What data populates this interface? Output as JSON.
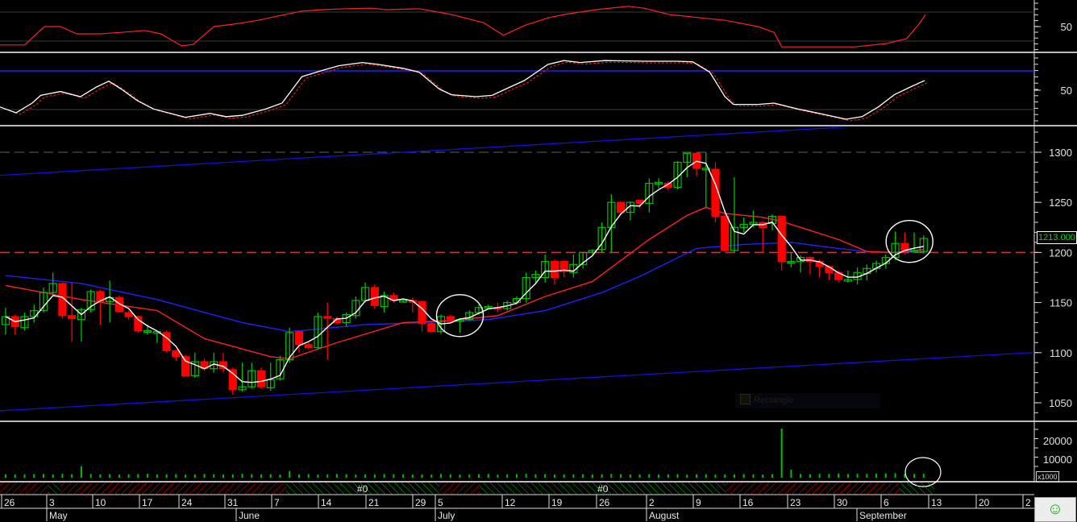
{
  "colors": {
    "bull": "#00c000",
    "bear": "#ff0000",
    "fast_ma": "#ffffff",
    "mid_ma": "#ff2020",
    "slow_ma": "#2020ff",
    "channel": "#1010e0",
    "bg": "#000000",
    "grid": "#3a3a3a"
  },
  "price_tag": "1213.000",
  "volume_unit": "x1000",
  "smiley_icon": "☺",
  "rectangle_label": "Rectangle",
  "chart_data": {
    "type": "candlestick",
    "ylim": [
      1035,
      1325
    ],
    "yticks": [
      "1050",
      "1100",
      "1150",
      "1200",
      "1250",
      "1300"
    ],
    "horizontal_lines": [
      {
        "price": 1300,
        "style": "dashed",
        "color": "#606060"
      },
      {
        "price": 1200,
        "style": "dashed",
        "color": "#ff2020"
      }
    ],
    "trendlines": [
      {
        "from": [
          -0.6,
          1277
        ],
        "to": [
          88.4,
          1325
        ]
      },
      {
        "from": [
          -0.6,
          1042
        ],
        "to": [
          108.4,
          1100
        ]
      }
    ],
    "circles": [
      {
        "slot": 48,
        "price": 1137
      },
      {
        "slot": 95.5,
        "price": 1211
      }
    ],
    "candles": [
      [
        1128,
        1145,
        1118,
        1136
      ],
      [
        1136,
        1138,
        1118,
        1126
      ],
      [
        1125,
        1140,
        1122,
        1136
      ],
      [
        1136,
        1148,
        1130,
        1142
      ],
      [
        1142,
        1165,
        1140,
        1160
      ],
      [
        1160,
        1180,
        1158,
        1169
      ],
      [
        1169,
        1170,
        1134,
        1137
      ],
      [
        1137,
        1170,
        1111,
        1134
      ],
      [
        1133,
        1145,
        1111,
        1143
      ],
      [
        1143,
        1163,
        1140,
        1161
      ],
      [
        1161,
        1163,
        1128,
        1151
      ],
      [
        1151,
        1172,
        1130,
        1155
      ],
      [
        1155,
        1157,
        1140,
        1141
      ],
      [
        1140,
        1142,
        1133,
        1136
      ],
      [
        1136,
        1137,
        1120,
        1122
      ],
      [
        1122,
        1128,
        1118,
        1122
      ],
      [
        1121,
        1122,
        1110,
        1121
      ],
      [
        1120,
        1122,
        1100,
        1102
      ],
      [
        1102,
        1103,
        1092,
        1096
      ],
      [
        1096,
        1098,
        1076,
        1077
      ],
      [
        1077,
        1100,
        1075,
        1091
      ],
      [
        1091,
        1094,
        1082,
        1084
      ],
      [
        1084,
        1100,
        1080,
        1091
      ],
      [
        1091,
        1100,
        1080,
        1084
      ],
      [
        1083,
        1085,
        1058,
        1063
      ],
      [
        1063,
        1090,
        1061,
        1066
      ],
      [
        1066,
        1090,
        1064,
        1082
      ],
      [
        1082,
        1085,
        1064,
        1066
      ],
      [
        1065,
        1090,
        1062,
        1073
      ],
      [
        1074,
        1097,
        1072,
        1093
      ],
      [
        1093,
        1125,
        1090,
        1120
      ],
      [
        1121,
        1122,
        1100,
        1108
      ],
      [
        1108,
        1110,
        1104,
        1105
      ],
      [
        1105,
        1140,
        1103,
        1136
      ],
      [
        1136,
        1150,
        1093,
        1135
      ],
      [
        1134,
        1136,
        1128,
        1130
      ],
      [
        1130,
        1140,
        1126,
        1138
      ],
      [
        1137,
        1156,
        1134,
        1152
      ],
      [
        1152,
        1170,
        1150,
        1165
      ],
      [
        1165,
        1168,
        1144,
        1147
      ],
      [
        1146,
        1161,
        1140,
        1157
      ],
      [
        1157,
        1160,
        1150,
        1152
      ],
      [
        1152,
        1153,
        1150,
        1152
      ],
      [
        1152,
        1155,
        1140,
        1151
      ],
      [
        1151,
        1152,
        1121,
        1129
      ],
      [
        1129,
        1130,
        1120,
        1121
      ],
      [
        1121,
        1138,
        1119,
        1136
      ],
      [
        1136,
        1138,
        1130,
        1132
      ],
      [
        1133,
        1134,
        1120,
        1133
      ],
      [
        1133,
        1142,
        1132,
        1140
      ],
      [
        1140,
        1148,
        1138,
        1145
      ],
      [
        1146,
        1148,
        1143,
        1146
      ],
      [
        1145,
        1150,
        1140,
        1144
      ],
      [
        1144,
        1152,
        1142,
        1150
      ],
      [
        1150,
        1156,
        1148,
        1154
      ],
      [
        1154,
        1180,
        1150,
        1175
      ],
      [
        1175,
        1182,
        1168,
        1178
      ],
      [
        1175,
        1198,
        1170,
        1191
      ],
      [
        1191,
        1193,
        1168,
        1175
      ],
      [
        1191,
        1192,
        1175,
        1181
      ],
      [
        1180,
        1198,
        1175,
        1188
      ],
      [
        1188,
        1200,
        1184,
        1200
      ],
      [
        1200,
        1203,
        1196,
        1202
      ],
      [
        1203,
        1230,
        1200,
        1225
      ],
      [
        1225,
        1258,
        1200,
        1250
      ],
      [
        1250,
        1251,
        1238,
        1240
      ],
      [
        1240,
        1251,
        1232,
        1250
      ],
      [
        1252,
        1253,
        1244,
        1249
      ],
      [
        1249,
        1274,
        1240,
        1269
      ],
      [
        1270,
        1274,
        1264,
        1270
      ],
      [
        1269,
        1271,
        1262,
        1265
      ],
      [
        1265,
        1291,
        1263,
        1290
      ],
      [
        1290,
        1299,
        1275,
        1299
      ],
      [
        1299,
        1300,
        1276,
        1284
      ],
      [
        1284,
        1300,
        1245,
        1284
      ],
      [
        1283,
        1290,
        1230,
        1236
      ],
      [
        1236,
        1242,
        1200,
        1202
      ],
      [
        1202,
        1275,
        1200,
        1225
      ],
      [
        1225,
        1235,
        1220,
        1228
      ],
      [
        1228,
        1242,
        1225,
        1230
      ],
      [
        1230,
        1231,
        1200,
        1225
      ],
      [
        1229,
        1238,
        1222,
        1236
      ],
      [
        1236,
        1237,
        1182,
        1191
      ],
      [
        1191,
        1200,
        1185,
        1191
      ],
      [
        1191,
        1197,
        1180,
        1195
      ],
      [
        1195,
        1196,
        1178,
        1191
      ],
      [
        1191,
        1193,
        1175,
        1186
      ],
      [
        1186,
        1187,
        1172,
        1180
      ],
      [
        1180,
        1182,
        1170,
        1173
      ],
      [
        1173,
        1182,
        1170,
        1173
      ],
      [
        1173,
        1185,
        1168,
        1180
      ],
      [
        1179,
        1188,
        1172,
        1184
      ],
      [
        1184,
        1192,
        1180,
        1189
      ],
      [
        1189,
        1198,
        1184,
        1195
      ],
      [
        1195,
        1221,
        1192,
        1209
      ],
      [
        1209,
        1220,
        1198,
        1202
      ],
      [
        1202,
        1220,
        1200,
        1202
      ],
      [
        1201,
        1217,
        1199,
        1214
      ]
    ],
    "mid_ma": [
      [
        0,
        1167
      ],
      [
        8,
        1153
      ],
      [
        16,
        1142
      ],
      [
        21,
        1114
      ],
      [
        28,
        1096
      ],
      [
        30,
        1094
      ],
      [
        35,
        1110
      ],
      [
        42,
        1130
      ],
      [
        47,
        1132
      ],
      [
        52,
        1137
      ],
      [
        57,
        1156
      ],
      [
        62,
        1171
      ],
      [
        68,
        1213
      ],
      [
        72,
        1237
      ],
      [
        74,
        1245
      ],
      [
        76,
        1239
      ],
      [
        80,
        1235
      ],
      [
        82,
        1231
      ],
      [
        88,
        1213
      ],
      [
        91,
        1201
      ],
      [
        94,
        1200
      ],
      [
        97,
        1203
      ]
    ],
    "slow_ma": [
      [
        0,
        1177
      ],
      [
        8,
        1169
      ],
      [
        16,
        1153
      ],
      [
        25,
        1130
      ],
      [
        30,
        1121
      ],
      [
        38,
        1128
      ],
      [
        44,
        1130
      ],
      [
        51,
        1133
      ],
      [
        57,
        1142
      ],
      [
        63,
        1160
      ],
      [
        67,
        1176
      ],
      [
        73,
        1204
      ],
      [
        78,
        1208
      ],
      [
        83,
        1210
      ],
      [
        88,
        1204
      ],
      [
        92,
        1200
      ],
      [
        97,
        1201
      ]
    ],
    "oscillator1": {
      "tick": "50",
      "points": [
        [
          -0.6,
          12
        ],
        [
          2,
          12
        ],
        [
          4.1,
          50
        ],
        [
          5.8,
          50
        ],
        [
          7.5,
          35
        ],
        [
          10,
          35
        ],
        [
          12.2,
          38
        ],
        [
          14.7,
          42
        ],
        [
          16.4,
          35
        ],
        [
          18.6,
          10
        ],
        [
          19.8,
          13
        ],
        [
          22,
          50
        ],
        [
          24.1,
          55
        ],
        [
          26.7,
          63
        ],
        [
          28.8,
          72
        ],
        [
          31.3,
          82
        ],
        [
          33.5,
          85
        ],
        [
          36,
          87
        ],
        [
          38.6,
          88
        ],
        [
          40.3,
          85
        ],
        [
          43.7,
          87
        ],
        [
          47.1,
          75
        ],
        [
          50.5,
          58
        ],
        [
          52.6,
          32
        ],
        [
          54.8,
          52
        ],
        [
          57.3,
          68
        ],
        [
          59,
          75
        ],
        [
          62.4,
          85
        ],
        [
          65.8,
          92
        ],
        [
          67.5,
          88
        ],
        [
          70.1,
          75
        ],
        [
          73.5,
          68
        ],
        [
          76,
          63
        ],
        [
          79.5,
          50
        ],
        [
          81.2,
          38
        ],
        [
          82,
          8
        ],
        [
          84.6,
          8
        ],
        [
          89.7,
          8
        ],
        [
          93.1,
          15
        ],
        [
          95.2,
          25
        ],
        [
          96.5,
          55
        ],
        [
          97.2,
          75
        ]
      ]
    },
    "oscillator2": {
      "tick": "50",
      "level": 80,
      "points": [
        [
          -0.6,
          24
        ],
        [
          1.1,
          15
        ],
        [
          2.8,
          30
        ],
        [
          3.7,
          42
        ],
        [
          5.8,
          48
        ],
        [
          7.9,
          40
        ],
        [
          9.6,
          55
        ],
        [
          10.9,
          64
        ],
        [
          12.2,
          52
        ],
        [
          13.9,
          34
        ],
        [
          15.6,
          21
        ],
        [
          19,
          8
        ],
        [
          21.6,
          14
        ],
        [
          23.3,
          9
        ],
        [
          25,
          11
        ],
        [
          27.5,
          21
        ],
        [
          29.2,
          30
        ],
        [
          31.3,
          71
        ],
        [
          33.5,
          81
        ],
        [
          35.2,
          88
        ],
        [
          37.7,
          93
        ],
        [
          39.4,
          90
        ],
        [
          42,
          84
        ],
        [
          43.7,
          78
        ],
        [
          45.8,
          52
        ],
        [
          47.1,
          43
        ],
        [
          49.7,
          40
        ],
        [
          51.4,
          42
        ],
        [
          53,
          53
        ],
        [
          54.8,
          65
        ],
        [
          57.3,
          90
        ],
        [
          59,
          96
        ],
        [
          60.7,
          93
        ],
        [
          63.3,
          96
        ],
        [
          67.5,
          95
        ],
        [
          70.9,
          95
        ],
        [
          72.6,
          94
        ],
        [
          74.4,
          78
        ],
        [
          76,
          40
        ],
        [
          76.9,
          28
        ],
        [
          79.5,
          28
        ],
        [
          81.2,
          30
        ],
        [
          83.7,
          21
        ],
        [
          86.3,
          13
        ],
        [
          88.8,
          5
        ],
        [
          90.5,
          9
        ],
        [
          92.2,
          24
        ],
        [
          93.9,
          43
        ],
        [
          95.6,
          55
        ],
        [
          97.1,
          65
        ]
      ]
    },
    "volume": {
      "yticks": [
        "20000",
        "10000"
      ],
      "values": [
        1800,
        1700,
        1800,
        1900,
        2000,
        1800,
        2100,
        1900,
        6200,
        2000,
        1800,
        1900,
        1700,
        1800,
        2000,
        2100,
        1700,
        1800,
        1900,
        1700,
        1800,
        2000,
        1900,
        1700,
        1800,
        2100,
        1900,
        1800,
        1900,
        1700,
        3600,
        1800,
        1900,
        1700,
        1800,
        2000,
        1900,
        1700,
        1800,
        1700,
        2000,
        1900,
        1800,
        1700,
        1800,
        1700,
        2000,
        1800,
        1700,
        1800,
        1900,
        2000,
        1700,
        1800,
        1900,
        2100,
        1800,
        1900,
        1700,
        1800,
        1800,
        1900,
        1700,
        1800,
        2000,
        1900,
        1700,
        1800,
        1900,
        1700,
        1800,
        1900,
        1700,
        1800,
        1900,
        1700,
        1800,
        1700,
        1900,
        1800,
        1700,
        1900,
        26500,
        4300,
        2000,
        1900,
        2100,
        2000,
        2200,
        2000,
        2100,
        2100,
        2200,
        2300,
        2400,
        2200,
        2000,
        2100
      ]
    },
    "trend_bands": [
      {
        "from": -0.6,
        "to": 4.5,
        "state": "bear"
      },
      {
        "from": 4.5,
        "to": 5.8,
        "state": "bull"
      },
      {
        "from": 5.8,
        "to": 29.6,
        "state": "bear"
      },
      {
        "from": 29.6,
        "to": 45.8,
        "state": "bull",
        "label": "#0"
      },
      {
        "from": 45.8,
        "to": 50.1,
        "state": "bear"
      },
      {
        "from": 50.1,
        "to": 76.1,
        "state": "bull",
        "label": "#0"
      },
      {
        "from": 76.1,
        "to": 94.4,
        "state": "bear"
      },
      {
        "from": 94.4,
        "to": 98.1,
        "state": "bull"
      }
    ],
    "x_day_labels": [
      "26",
      "3",
      "10",
      "17",
      "24",
      "31",
      "7",
      "14",
      "21",
      "29",
      "5",
      "12",
      "19",
      "26",
      "2",
      "9",
      "16",
      "23",
      "30",
      "6",
      "13",
      "20",
      "2"
    ],
    "x_month_labels": [
      "May",
      "June",
      "July",
      "August",
      "September"
    ]
  }
}
